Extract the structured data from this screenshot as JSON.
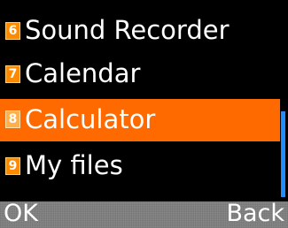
{
  "menu": {
    "items": [
      {
        "number": "6",
        "label": "Sound Recorder"
      },
      {
        "number": "7",
        "label": "Calendar"
      },
      {
        "number": "8",
        "label": "Calculator"
      },
      {
        "number": "9",
        "label": "My files"
      }
    ],
    "selected_index": 2
  },
  "softkeys": {
    "left": "OK",
    "right": "Back"
  },
  "colors": {
    "background": "#000000",
    "highlight": "#ff6a00",
    "badge": "#ff8a00",
    "scrollbar": "#1f8cff",
    "softkey_bar": "#8a8a8a"
  }
}
